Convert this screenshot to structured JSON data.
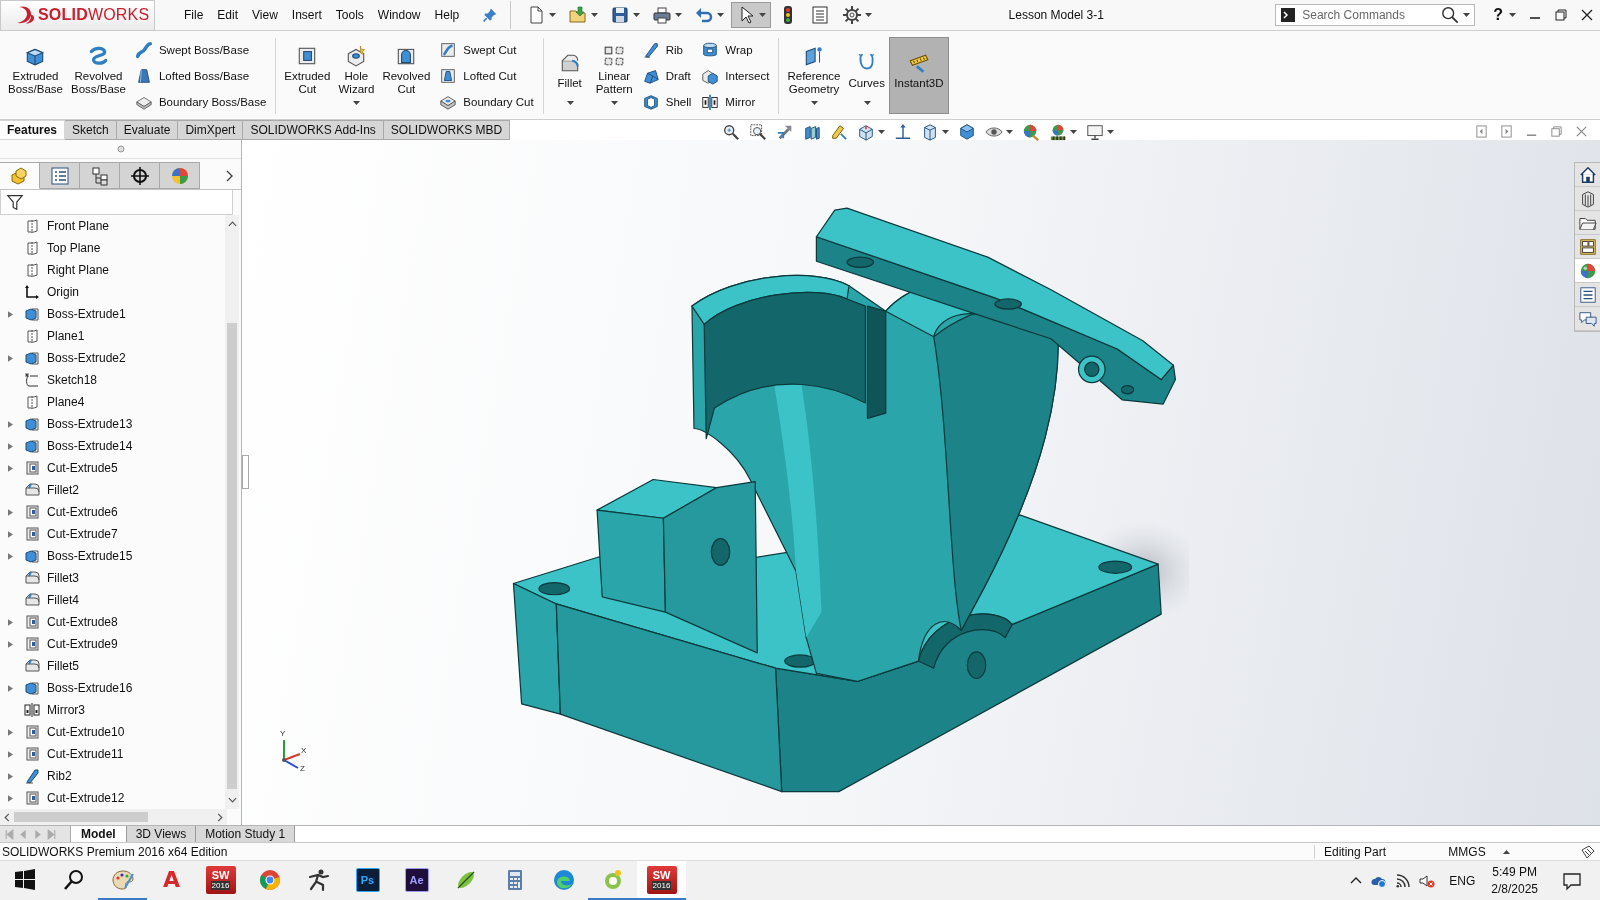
{
  "title_bar": {
    "logo": "**SOLID**WORKS",
    "menus": [
      "File",
      "Edit",
      "View",
      "Insert",
      "Tools",
      "Window",
      "Help"
    ],
    "quick_access": [
      {
        "has_menu": true,
        "pressed": false
      },
      {
        "has_menu": true,
        "pressed": false
      },
      {
        "has_menu": true,
        "pressed": false
      },
      {
        "has_menu": true,
        "pressed": false
      },
      {
        "has_menu": true,
        "pressed": false
      },
      {
        "has_menu": true,
        "pressed": true
      },
      {
        "has_menu": false,
        "pressed": false
      },
      {
        "has_menu": false,
        "pressed": false
      },
      {
        "has_menu": true,
        "pressed": false
      }
    ],
    "document_title": "Lesson Model 3-1",
    "search": {
      "placeholder": "Search Commands"
    },
    "help": "?"
  },
  "command_manager": {
    "groups": [
      {
        "items": [
          {
            "label": "Extruded Boss/Base",
            "kind": "large",
            "has_menu": false,
            "pressed": false
          },
          {
            "label": "Revolved Boss/Base",
            "kind": "large",
            "has_menu": false,
            "pressed": false
          },
          {
            "label": "Swept Boss/Base",
            "kind": "small",
            "has_menu": false,
            "pressed": false
          },
          {
            "label": "Lofted Boss/Base",
            "kind": "small",
            "has_menu": false,
            "pressed": false
          },
          {
            "label": "Boundary Boss/Base",
            "kind": "small",
            "has_menu": false,
            "pressed": false
          }
        ]
      },
      {
        "items": [
          {
            "label": "Extruded Cut",
            "kind": "large",
            "has_menu": false,
            "pressed": false
          },
          {
            "label": "Hole Wizard",
            "kind": "large",
            "has_menu": true,
            "pressed": false
          },
          {
            "label": "Revolved Cut",
            "kind": "large",
            "has_menu": false,
            "pressed": false
          },
          {
            "label": "Swept Cut",
            "kind": "small",
            "has_menu": false,
            "pressed": false
          },
          {
            "label": "Lofted Cut",
            "kind": "small",
            "has_menu": false,
            "pressed": false
          },
          {
            "label": "Boundary Cut",
            "kind": "small",
            "has_menu": false,
            "pressed": false
          }
        ]
      },
      {
        "items": [
          {
            "label": "Fillet",
            "kind": "large",
            "has_menu": true,
            "pressed": false
          },
          {
            "label": "Linear Pattern",
            "kind": "large",
            "has_menu": true,
            "pressed": false
          },
          {
            "label": "Rib",
            "kind": "small",
            "has_menu": false,
            "pressed": false
          },
          {
            "label": "Draft",
            "kind": "small",
            "has_menu": false,
            "pressed": false
          },
          {
            "label": "Shell",
            "kind": "small",
            "has_menu": false,
            "pressed": false
          },
          {
            "label": "Wrap",
            "kind": "small",
            "has_menu": false,
            "pressed": false
          },
          {
            "label": "Intersect",
            "kind": "small",
            "has_menu": false,
            "pressed": false
          },
          {
            "label": "Mirror",
            "kind": "small",
            "has_menu": false,
            "pressed": false
          }
        ]
      },
      {
        "items": [
          {
            "label": "Reference Geometry",
            "kind": "large",
            "has_menu": true,
            "pressed": false
          },
          {
            "label": "Curves",
            "kind": "large",
            "has_menu": true,
            "pressed": false
          },
          {
            "label": "Instant3D",
            "kind": "large",
            "has_menu": false,
            "pressed": true
          }
        ]
      }
    ]
  },
  "command_tabs": [
    {
      "label": "Features",
      "selected": true
    },
    {
      "label": "Sketch",
      "selected": false
    },
    {
      "label": "Evaluate",
      "selected": false
    },
    {
      "label": "DimXpert",
      "selected": false
    },
    {
      "label": "SOLIDWORKS Add-Ins",
      "selected": false
    },
    {
      "label": "SOLIDWORKS MBD",
      "selected": false
    }
  ],
  "view_toolbar": [
    {
      "has_menu": false
    },
    {
      "has_menu": false
    },
    {
      "has_menu": false
    },
    {
      "has_menu": false
    },
    {
      "has_menu": false
    },
    {
      "has_menu": true
    },
    {
      "has_menu": false
    },
    {
      "has_menu": true
    },
    {
      "has_menu": false
    },
    {
      "has_menu": true
    },
    {
      "has_menu": false
    },
    {
      "has_menu": true
    },
    {
      "has_menu": true
    }
  ],
  "feature_manager": {
    "panel_tabs": [
      {
        "selected": true
      },
      {
        "selected": false
      },
      {
        "selected": false
      },
      {
        "selected": false
      },
      {
        "selected": false
      }
    ],
    "tree": [
      {
        "label": "Front Plane",
        "kind": "plane",
        "expandable": false
      },
      {
        "label": "Top Plane",
        "kind": "plane",
        "expandable": false
      },
      {
        "label": "Right Plane",
        "kind": "plane",
        "expandable": false
      },
      {
        "label": "Origin",
        "kind": "origin",
        "expandable": false
      },
      {
        "label": "Boss-Extrude1",
        "kind": "boss",
        "expandable": true
      },
      {
        "label": "Plane1",
        "kind": "plane",
        "expandable": false
      },
      {
        "label": "Boss-Extrude2",
        "kind": "boss",
        "expandable": true
      },
      {
        "label": "Sketch18",
        "kind": "sketch",
        "expandable": false
      },
      {
        "label": "Plane4",
        "kind": "plane",
        "expandable": false
      },
      {
        "label": "Boss-Extrude13",
        "kind": "boss",
        "expandable": true
      },
      {
        "label": "Boss-Extrude14",
        "kind": "boss",
        "expandable": true
      },
      {
        "label": "Cut-Extrude5",
        "kind": "cut",
        "expandable": true
      },
      {
        "label": "Fillet2",
        "kind": "fillet",
        "expandable": false
      },
      {
        "label": "Cut-Extrude6",
        "kind": "cut",
        "expandable": true
      },
      {
        "label": "Cut-Extrude7",
        "kind": "cut",
        "expandable": true
      },
      {
        "label": "Boss-Extrude15",
        "kind": "boss",
        "expandable": true
      },
      {
        "label": "Fillet3",
        "kind": "fillet",
        "expandable": false
      },
      {
        "label": "Fillet4",
        "kind": "fillet",
        "expandable": false
      },
      {
        "label": "Cut-Extrude8",
        "kind": "cut",
        "expandable": true
      },
      {
        "label": "Cut-Extrude9",
        "kind": "cut",
        "expandable": true
      },
      {
        "label": "Fillet5",
        "kind": "fillet",
        "expandable": false
      },
      {
        "label": "Boss-Extrude16",
        "kind": "boss",
        "expandable": true
      },
      {
        "label": "Mirror3",
        "kind": "mirror",
        "expandable": false
      },
      {
        "label": "Cut-Extrude10",
        "kind": "cut",
        "expandable": true
      },
      {
        "label": "Cut-Extrude11",
        "kind": "cut",
        "expandable": true
      },
      {
        "label": "Rib2",
        "kind": "rib",
        "expandable": true
      },
      {
        "label": "Cut-Extrude12",
        "kind": "cut",
        "expandable": true
      }
    ]
  },
  "task_pane": [
    {
      "selected": false
    },
    {
      "selected": false
    },
    {
      "selected": false
    },
    {
      "selected": false
    },
    {
      "selected": true
    },
    {
      "selected": false
    },
    {
      "selected": false
    }
  ],
  "triad": {
    "axes": [
      "Y",
      "X",
      "Z"
    ]
  },
  "model_tabs": [
    {
      "label": "Model",
      "selected": true
    },
    {
      "label": "3D Views",
      "selected": false
    },
    {
      "label": "Motion Study 1",
      "selected": false
    }
  ],
  "status_bar": {
    "edition": "SOLIDWORKS Premium 2016 x64 Edition",
    "mode": "Editing Part",
    "units": "MMGS"
  },
  "taskbar": {
    "apps": [
      {
        "running": false,
        "active": false
      },
      {
        "running": false,
        "active": false
      },
      {
        "running": true,
        "active": false
      },
      {
        "running": false,
        "active": false,
        "icon_text": "A"
      },
      {
        "running": false,
        "active": false,
        "icon_text": "SW",
        "icon_subtext": "2016"
      },
      {
        "running": false,
        "active": false
      },
      {
        "running": false,
        "active": false
      },
      {
        "running": false,
        "active": false,
        "icon_text": "Ps"
      },
      {
        "running": false,
        "active": false,
        "icon_text": "Ae"
      },
      {
        "running": false,
        "active": false
      },
      {
        "running": false,
        "active": false
      },
      {
        "running": false,
        "active": false
      },
      {
        "running": true,
        "active": false
      },
      {
        "running": true,
        "active": true,
        "icon_text": "SW",
        "icon_subtext": "2016"
      }
    ],
    "tray": {
      "language": "ENG",
      "time": "5:49 PM",
      "date": "2/8/2025"
    }
  }
}
